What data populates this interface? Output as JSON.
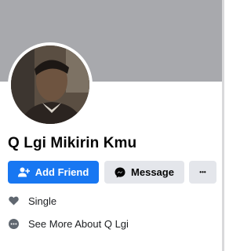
{
  "profile": {
    "name": "Q Lgi Mikirin Kmu"
  },
  "actions": {
    "add_friend_label": "Add Friend",
    "message_label": "Message",
    "more_label": "•••"
  },
  "info": {
    "items": [
      {
        "icon": "heart-icon",
        "label": "Single"
      },
      {
        "icon": "more-dots-icon",
        "label": "See More About Q Lgi"
      }
    ]
  },
  "colors": {
    "primary": "#1877f2",
    "button_secondary": "#e4e6eb",
    "cover": "#a8a9ad",
    "text": "#050505",
    "icon_gray": "#606770"
  }
}
